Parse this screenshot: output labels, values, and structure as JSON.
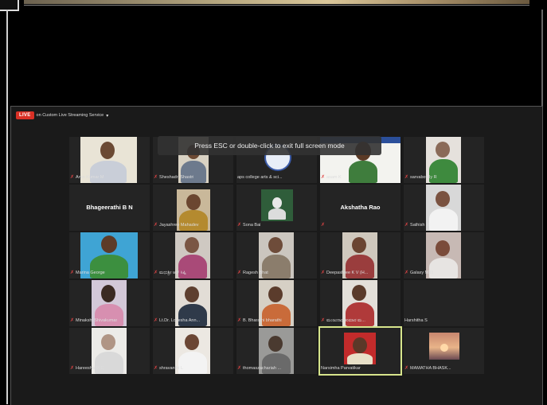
{
  "live_badge": "LIVE",
  "stream_service": "on Custom Live Streaming Service",
  "fullscreen_toast": "Press ESC or double-click to exit full screen mode",
  "colors": {
    "live": "#d93025",
    "active_speaker": "#d7e58c",
    "mute": "#e04444",
    "tile_bg": "#242424"
  },
  "participants": [
    {
      "name": "Arun Kumar M",
      "tile": "video"
    },
    {
      "name": "Sheshadri Shastri",
      "tile": "video"
    },
    {
      "name": "aps college arts & sci...",
      "tile": "logo"
    },
    {
      "name": "asam K",
      "tile": "video-poster"
    },
    {
      "name": "sarvabotaly R",
      "tile": "video"
    },
    {
      "name": "Bhageerathi B N",
      "tile": "name-only"
    },
    {
      "name": "Jayashree Mahadev",
      "tile": "video"
    },
    {
      "name": "Sona Bai",
      "tile": "image"
    },
    {
      "name": "Akshatha Rao",
      "tile": "name-only"
    },
    {
      "name": "Sathish M",
      "tile": "video"
    },
    {
      "name": "Marina George",
      "tile": "video"
    },
    {
      "name": "ಮಧುಶ್ರೀ ಆರ್ ಸಿಪ್ಪಿ",
      "tile": "video"
    },
    {
      "name": "Ragesh Bhat",
      "tile": "video"
    },
    {
      "name": "Deepashree K V (H...",
      "tile": "video"
    },
    {
      "name": "Galaxy M31",
      "tile": "video"
    },
    {
      "name": "Minakshi Shivakumar",
      "tile": "video"
    },
    {
      "name": "Lt.Dr. Lokesha Ann...",
      "tile": "video"
    },
    {
      "name": "B. Bharathi bharathi",
      "tile": "video"
    },
    {
      "name": "ಮಂಜುನಾಥ ಕುಮಾರ ಮ...",
      "tile": "video"
    },
    {
      "name": "Harshitha S",
      "tile": "blank"
    },
    {
      "name": "Hareesha M C",
      "tile": "video"
    },
    {
      "name": "shravanthi L",
      "tile": "video"
    },
    {
      "name": "thomaszachariah ...",
      "tile": "video"
    },
    {
      "name": "Narsimha Parvatikar",
      "tile": "video",
      "active": true
    },
    {
      "name": "MAMATHA BHASK...",
      "tile": "image"
    }
  ]
}
